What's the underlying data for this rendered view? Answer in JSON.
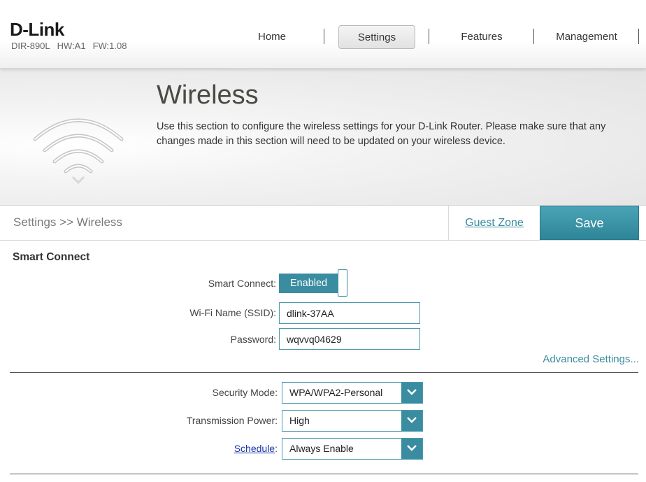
{
  "header": {
    "logo": "D-Link",
    "model": "DIR-890L",
    "hw": "HW:A1",
    "fw": "FW:1.08"
  },
  "nav": {
    "items": [
      {
        "label": "Home",
        "active": false
      },
      {
        "label": "Settings",
        "active": true
      },
      {
        "label": "Features",
        "active": false
      },
      {
        "label": "Management",
        "active": false
      }
    ]
  },
  "banner": {
    "title": "Wireless",
    "description": "Use this section to configure the wireless settings for your D-Link Router. Please make sure that any changes made in this section will need to be updated on your wireless device.",
    "icon": "wifi-icon"
  },
  "toolbar": {
    "breadcrumb": "Settings >> Wireless",
    "guest_zone_label": "Guest Zone",
    "save_label": "Save"
  },
  "smart_connect": {
    "section_title": "Smart Connect",
    "toggle_label": "Smart Connect:",
    "toggle_value": "Enabled",
    "ssid_label": "Wi-Fi Name (SSID):",
    "ssid_value": "dlink-37AA",
    "password_label": "Password:",
    "password_value": "wqvvq04629",
    "advanced_label": "Advanced Settings..."
  },
  "security": {
    "mode_label": "Security Mode:",
    "mode_value": "WPA/WPA2-Personal",
    "power_label": "Transmission Power:",
    "power_value": "High",
    "schedule_link": "Schedule",
    "schedule_colon": ":",
    "schedule_value": "Always Enable"
  },
  "colors": {
    "accent": "#3a8da0",
    "link": "#3a8c9e",
    "schedule_link": "#1a33a8"
  }
}
